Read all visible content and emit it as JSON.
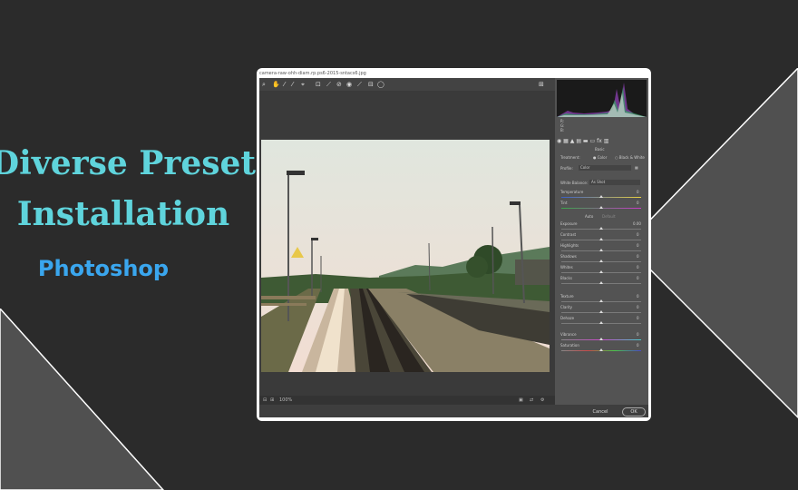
{
  "hero": {
    "title_line1": "Diverse Preset",
    "title_line2": "Installation",
    "subtitle": "Photoshop"
  },
  "window": {
    "filename": "camera-raw-ohh-diam.rp.ps6-2015-sntacs6.jpg",
    "zoom": "100%",
    "cancel_label": "Cancel",
    "ok_label": "OK"
  },
  "panel": {
    "rgb_labels": [
      "R:",
      "G:",
      "B:"
    ],
    "tab_basic": "Basic",
    "treatment_label": "Treatment:",
    "treatment_color": "Color",
    "treatment_bw": "Black & White",
    "profile_label": "Profile:",
    "profile_value": "Color",
    "white_balance_label": "White Balance:",
    "white_balance_value": "As Shot",
    "auto_label": "Auto",
    "default_label": "Default",
    "sliders": [
      {
        "label": "Temperature",
        "value": "0"
      },
      {
        "label": "Tint",
        "value": "0"
      },
      {
        "label": "Exposure",
        "value": "0.00"
      },
      {
        "label": "Contrast",
        "value": "0"
      },
      {
        "label": "Highlights",
        "value": "0"
      },
      {
        "label": "Shadows",
        "value": "0"
      },
      {
        "label": "Whites",
        "value": "0"
      },
      {
        "label": "Blacks",
        "value": "0"
      },
      {
        "label": "Texture",
        "value": "0"
      },
      {
        "label": "Clarity",
        "value": "0"
      },
      {
        "label": "Dehaze",
        "value": "0"
      },
      {
        "label": "Vibrance",
        "value": "0"
      },
      {
        "label": "Saturation",
        "value": "0"
      }
    ]
  },
  "colors": {
    "background": "#2b2b2b",
    "accent_title": "#5fd4dc",
    "accent_subtitle": "#3aa6ee"
  }
}
